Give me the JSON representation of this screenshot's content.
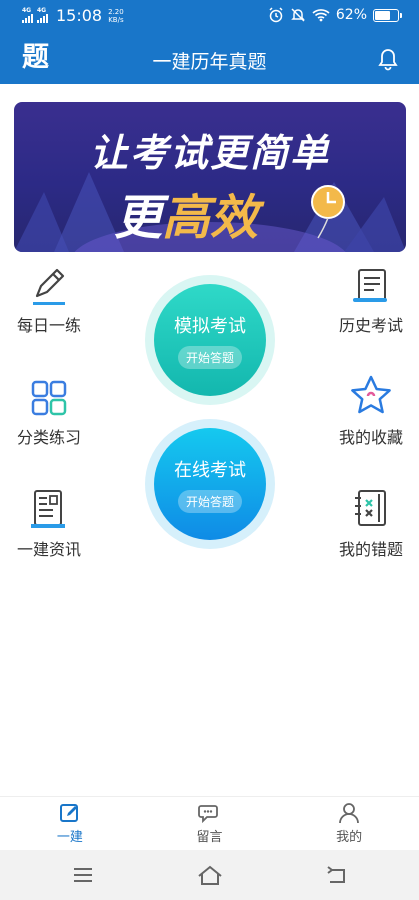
{
  "status_bar": {
    "network1": "4G",
    "network2": "4G",
    "time": "15:08",
    "speed_value": "2.20",
    "speed_unit": "KB/s",
    "battery": "62%",
    "battery_level": 0.62
  },
  "app_bar": {
    "logo": "题",
    "title": "一建历年真题"
  },
  "banner": {
    "line1": "让考试更简单",
    "line2_prefix": "更",
    "line2_highlight": "高效"
  },
  "features_left": [
    {
      "label": "每日一练",
      "icon": "pencil-icon"
    },
    {
      "label": "分类练习",
      "icon": "grid-icon"
    },
    {
      "label": "一建资讯",
      "icon": "newspaper-icon"
    }
  ],
  "features_right": [
    {
      "label": "历史考试",
      "icon": "scroll-icon"
    },
    {
      "label": "我的收藏",
      "icon": "star-icon"
    },
    {
      "label": "我的错题",
      "icon": "notebook-icon"
    }
  ],
  "center": {
    "mock": {
      "title": "模拟考试",
      "button": "开始答题"
    },
    "online": {
      "title": "在线考试",
      "button": "开始答题"
    }
  },
  "tabs": [
    {
      "label": "一建",
      "icon": "edit-icon",
      "active": true
    },
    {
      "label": "留言",
      "icon": "chat-icon",
      "active": false
    },
    {
      "label": "我的",
      "icon": "user-icon",
      "active": false
    }
  ],
  "colors": {
    "primary": "#1976c9",
    "mock_gradient": [
      "#2fd9c8",
      "#13b7ae"
    ],
    "online_gradient": [
      "#15c9ef",
      "#0f8be6"
    ]
  }
}
